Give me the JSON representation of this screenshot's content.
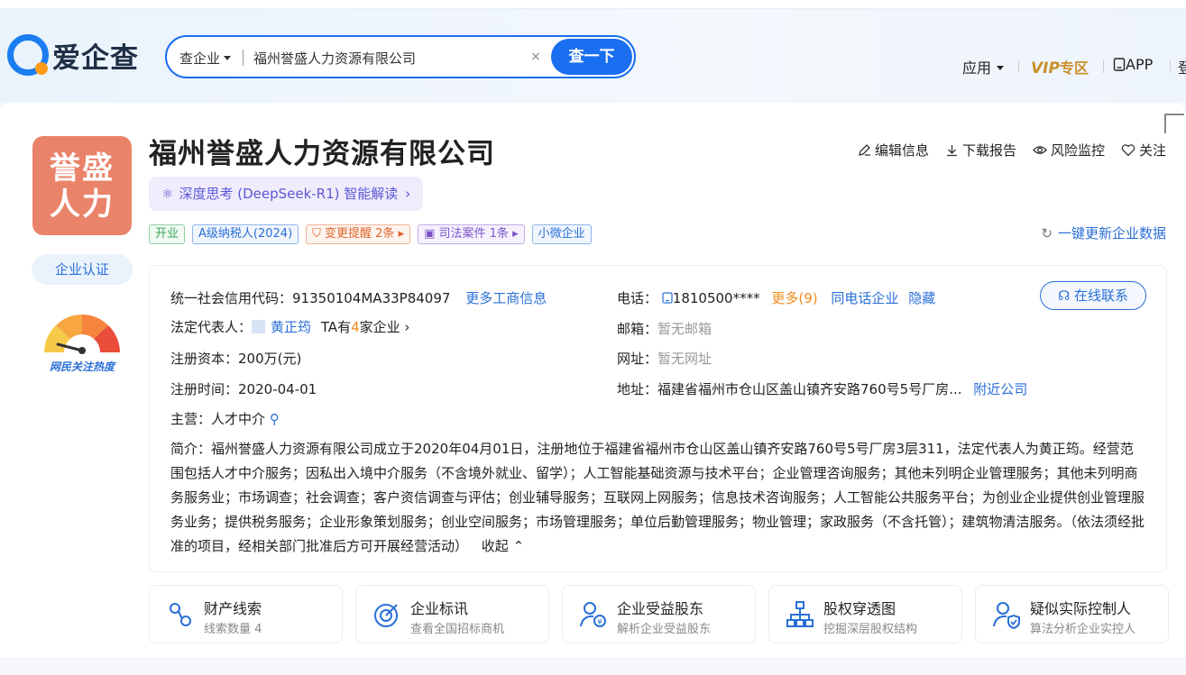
{
  "header": {
    "logo_text": "爱企查",
    "search": {
      "type_label": "查企业",
      "value": "福州誉盛人力资源有限公司",
      "clear_icon": "×",
      "button_label": "查一下"
    },
    "nav": {
      "app_label": "应用",
      "vip_label": "VIP",
      "vip_zone": "专区",
      "app_download": "APP",
      "login": "登"
    }
  },
  "company": {
    "logo_line1": "誉盛",
    "logo_line2": "人力",
    "name": "福州誉盛人力资源有限公司",
    "ai_chip": "深度思考 (DeepSeek-R1) 智能解读",
    "certification": "企业认证",
    "heat_label": "网民关注热度",
    "actions": {
      "edit": "编辑信息",
      "download": "下载报告",
      "monitor": "风险监控",
      "follow": "关注"
    },
    "tags": {
      "open": "开业",
      "taxpayer": "A级纳税人(2024)",
      "change": "变更提醒 2条",
      "judicial": "司法案件 1条",
      "small": "小微企业"
    },
    "refresh": "一键更新企业数据"
  },
  "info": {
    "credit_code_label": "统一社会信用代码：",
    "credit_code": "91350104MA33P84097",
    "more_business": "更多工商信息",
    "legal_label": "法定代表人：",
    "legal_name": "黄正筠",
    "legal_ta_prefix": "TA有",
    "legal_ta_count": "4",
    "legal_ta_suffix": "家企业",
    "capital_label": "注册资本：",
    "capital": "200万(元)",
    "reg_date_label": "注册时间：",
    "reg_date": "2020-04-01",
    "phone_label": "电话：",
    "phone": "1810500****",
    "phone_more": "更多(9)",
    "same_phone": "同电话企业",
    "hide": "隐藏",
    "email_label": "邮箱：",
    "email": "暂无邮箱",
    "website_label": "网址：",
    "website": "暂无网址",
    "address_label": "地址：",
    "address": "福建省福州市仓山区盖山镇齐安路760号5号厂房...",
    "nearby": "附近公司",
    "main_business_label": "主营：",
    "main_business": "人才中介",
    "online_contact": "在线联系",
    "desc_label": "简介：",
    "desc": "福州誉盛人力资源有限公司成立于2020年04月01日，注册地位于福建省福州市仓山区盖山镇齐安路760号5号厂房3层311，法定代表人为黄正筠。经营范围包括人才中介服务；因私出入境中介服务（不含境外就业、留学）；人工智能基础资源与技术平台；企业管理咨询服务；其他未列明企业管理服务；其他未列明商务服务业；市场调查；社会调查；客户资信调查与评估；创业辅导服务；互联网上网服务；信息技术咨询服务；人工智能公共服务平台；为创业企业提供创业管理服务业务；提供税务服务；企业形象策划服务；创业空间服务；市场管理服务；单位后勤管理服务；物业管理；家政服务（不含托管）；建筑物清洁服务。（依法须经批准的项目，经相关部门批准后方可开展经营活动）",
    "collapse": "收起"
  },
  "features": [
    {
      "title": "财产线索",
      "sub": "线索数量 4",
      "icon": "property-clue-icon"
    },
    {
      "title": "企业标讯",
      "sub": "查看全国招标商机",
      "icon": "bid-target-icon"
    },
    {
      "title": "企业受益股东",
      "sub": "解析企业受益股东",
      "icon": "beneficiary-icon"
    },
    {
      "title": "股权穿透图",
      "sub": "挖掘深层股权结构",
      "icon": "equity-tree-icon"
    },
    {
      "title": "疑似实际控制人",
      "sub": "算法分析企业实控人",
      "icon": "controller-icon"
    }
  ],
  "colors": {
    "brand_blue": "#1a6ef0",
    "logo_orange": "#e9836a",
    "vip_gold": "#c8912d"
  }
}
